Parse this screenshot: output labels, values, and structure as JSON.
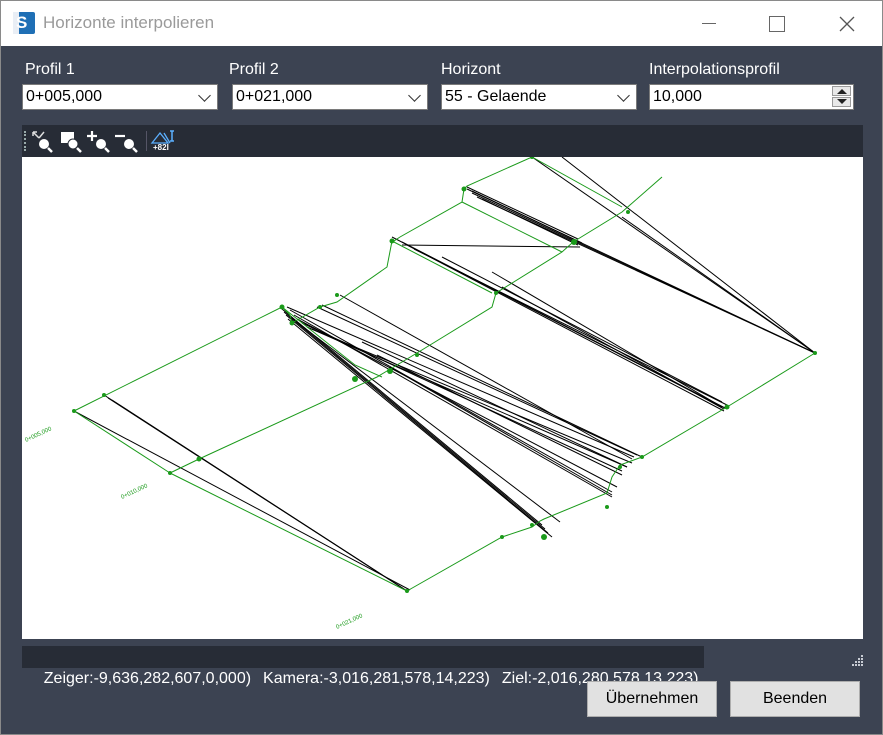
{
  "window": {
    "title": "Horizonte interpolieren",
    "icon": "app-logo-icon"
  },
  "fields": {
    "profil1": {
      "label": "Profil 1",
      "value": "0+005,000"
    },
    "profil2": {
      "label": "Profil 2",
      "value": "0+021,000"
    },
    "horizont": {
      "label": "Horizont",
      "value": "55 - Gelaende"
    },
    "interpolationsprofil": {
      "label": "Interpolationsprofil",
      "value": "10,000"
    }
  },
  "toolbar": {
    "tools": [
      "zoom-extents-icon",
      "zoom-window-icon",
      "zoom-in-icon",
      "zoom-out-icon",
      "view-3d-icon"
    ],
    "view_label": "+82I"
  },
  "canvas": {
    "profile_labels": [
      "0+005,000",
      "0+010,000",
      "0+021,000"
    ],
    "line_colors": {
      "profile": "#1a9a1a",
      "horizon": "#000000"
    }
  },
  "status": {
    "zeiger": "Zeiger:-9,636,282,607,0,000)",
    "kamera": "Kamera:-3,016,281,578,14,223)",
    "ziel": "Ziel:-2,016,280,578,13,223)"
  },
  "buttons": {
    "apply": "Übernehmen",
    "close": "Beenden"
  }
}
